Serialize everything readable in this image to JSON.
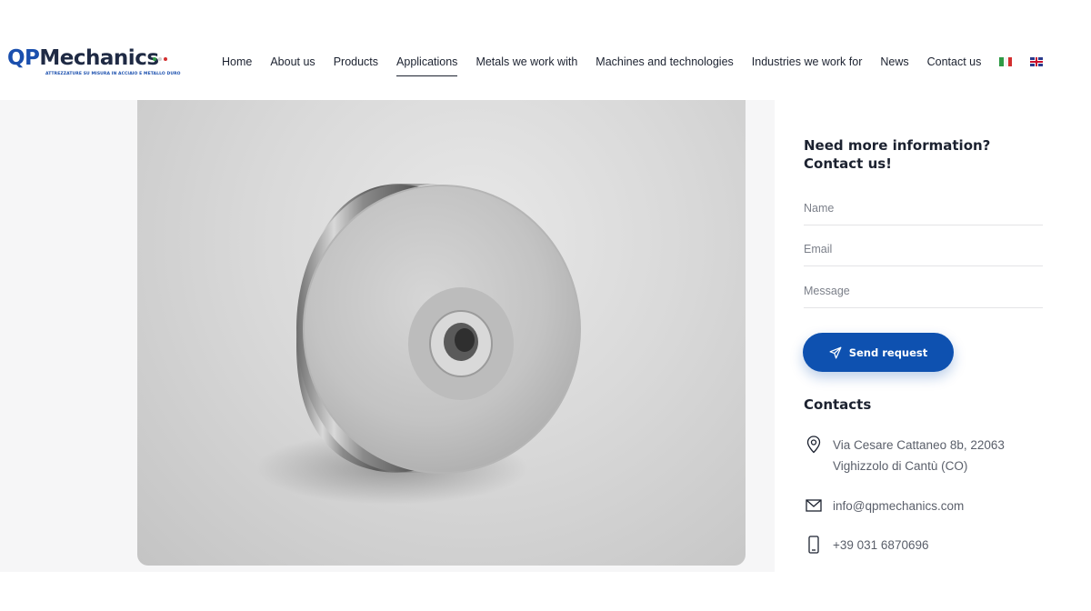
{
  "brand": {
    "logo_qp": "QP",
    "logo_rest": "Mechanics",
    "tagline": "ATTREZZATURE SU MISURA IN ACCIAIO E METALLO DURO",
    "colors": {
      "primary": "#0e51b0",
      "dark": "#1c2230"
    }
  },
  "nav": {
    "items": [
      {
        "label": "Home"
      },
      {
        "label": "About us"
      },
      {
        "label": "Products"
      },
      {
        "label": "Applications",
        "active": true
      },
      {
        "label": "Metals we work with"
      },
      {
        "label": "Machines and technologies"
      },
      {
        "label": "Industries we work for"
      },
      {
        "label": "News"
      },
      {
        "label": "Contact us"
      }
    ],
    "languages": [
      "it-flag-icon",
      "en-flag-icon"
    ]
  },
  "product_image": {
    "icon": "metal-disc-image"
  },
  "form": {
    "title": "Need more information? Contact us!",
    "name_placeholder": "Name",
    "email_placeholder": "Email",
    "message_placeholder": "Message",
    "submit_label": "Send request",
    "submit_icon": "paper-plane-icon"
  },
  "contacts": {
    "title": "Contacts",
    "address_line1": "Via Cesare Cattaneo 8b, 22063",
    "address_line2": "Vighizzolo di Cantù (CO)",
    "email": "info@qpmechanics.com",
    "phone": "+39 031 6870696"
  }
}
